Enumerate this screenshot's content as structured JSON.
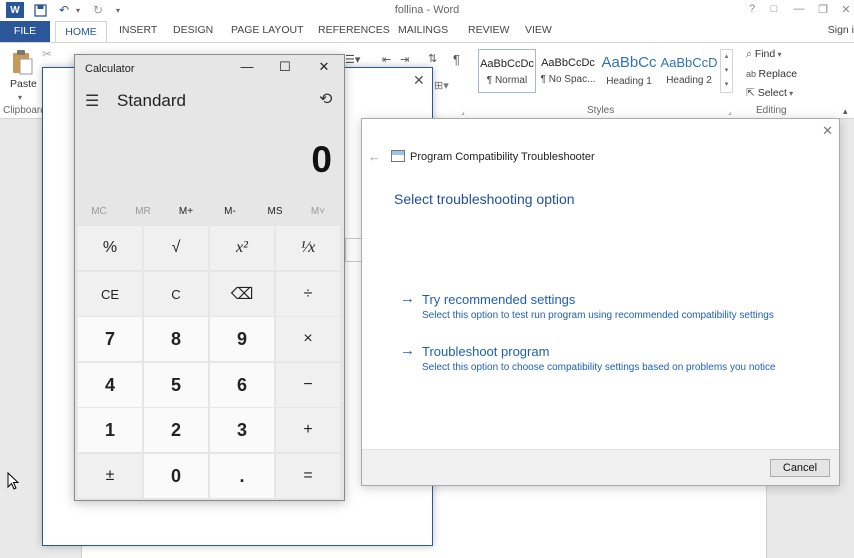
{
  "word": {
    "title": "follina - Word",
    "qat": {
      "save_icon": "save-icon",
      "undo_icon": "undo-icon",
      "redo_icon": "redo-icon"
    },
    "window_controls": [
      "?",
      "□",
      "—",
      "❐",
      "✕"
    ],
    "tabs": {
      "file": "FILE",
      "home": "HOME",
      "insert": "INSERT",
      "design": "DESIGN",
      "page_layout": "PAGE LAYOUT",
      "references": "REFERENCES",
      "mailings": "MAILINGS",
      "review": "REVIEW",
      "view": "VIEW"
    },
    "sign_in": "Sign i",
    "ribbon": {
      "paste_label": "Paste",
      "clipboard_label": "Clipboard",
      "styles_label": "Styles",
      "editing_label": "Editing",
      "styles": [
        {
          "sample": "AaBbCcDc",
          "name": "¶ Normal"
        },
        {
          "sample": "AaBbCcDc",
          "name": "¶ No Spac..."
        },
        {
          "sample": "AaBbCc",
          "name": "Heading 1"
        },
        {
          "sample": "AaBbCcD",
          "name": "Heading 2"
        }
      ],
      "find": "Find",
      "replace": "Replace",
      "select": "Select"
    },
    "accent": "#2b579a"
  },
  "calculator": {
    "title": "Calculator",
    "mode": "Standard",
    "display": "0",
    "memory": [
      "MC",
      "MR",
      "M+",
      "M-",
      "MS",
      "M˅"
    ],
    "keys": [
      [
        "%",
        "√",
        "x²",
        "¹⁄x"
      ],
      [
        "CE",
        "C",
        "⌫",
        "÷"
      ],
      [
        "7",
        "8",
        "9",
        "×"
      ],
      [
        "4",
        "5",
        "6",
        "−"
      ],
      [
        "1",
        "2",
        "3",
        "+"
      ],
      [
        "±",
        "0",
        ".",
        "="
      ]
    ]
  },
  "troubleshooter": {
    "app_title": "Program Compatibility Troubleshooter",
    "heading": "Select troubleshooting option",
    "options": [
      {
        "title": "Try recommended settings",
        "desc": "Select this option to test run program using recommended compatibility settings"
      },
      {
        "title": "Troubleshoot program",
        "desc": "Select this option to choose compatibility settings based on problems you notice"
      }
    ],
    "cancel": "Cancel",
    "link_color": "#1f5fb3"
  }
}
